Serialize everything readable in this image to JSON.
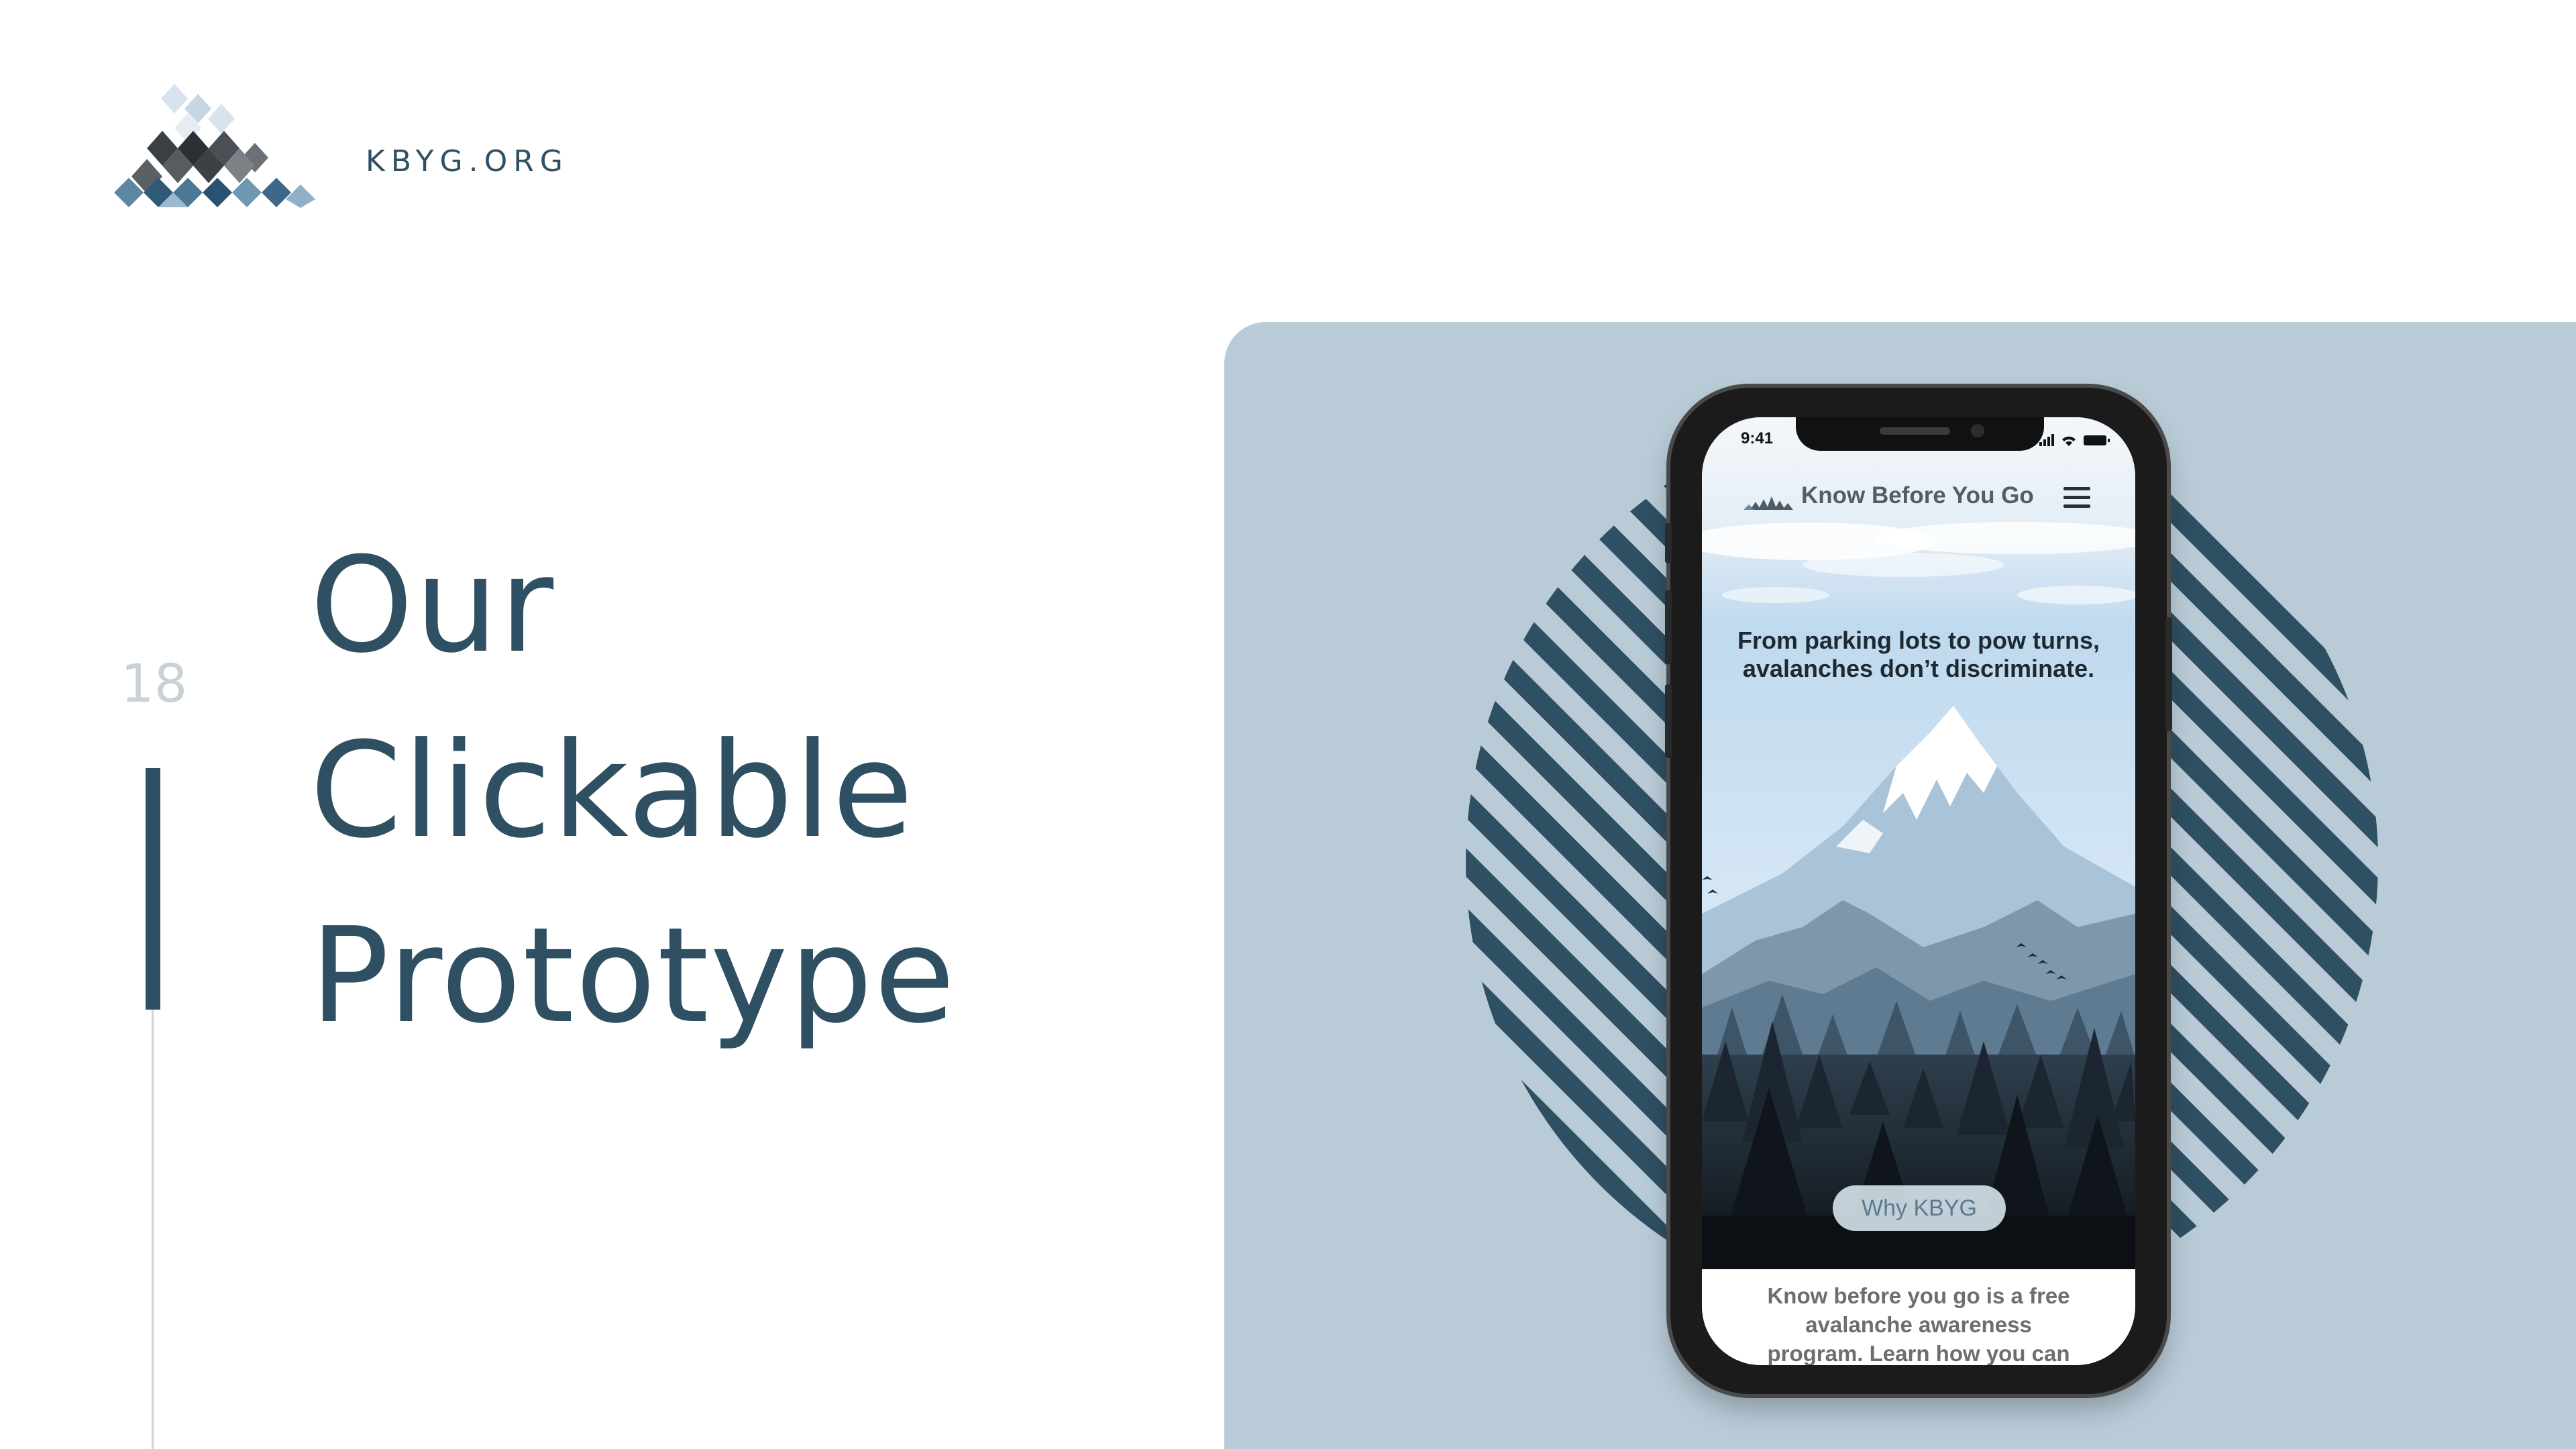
{
  "header": {
    "site_label": "KBYG.ORG"
  },
  "slide": {
    "number": "18",
    "title_lines": [
      "Our",
      "Clickable",
      "Prototype"
    ]
  },
  "phone": {
    "status_time": "9:41",
    "app_name": "Know Before You Go",
    "tagline_lines": [
      "From parking lots to pow turns,",
      "avalanches don’t discriminate."
    ],
    "cta_label": "Why KBYG",
    "intro_lines": [
      "Know before you go is a free",
      "avalanche awareness",
      "program. Learn how you can"
    ]
  },
  "colors": {
    "brand_navy": "#2f4f62",
    "panel_blue": "#b8cbd7",
    "slide_number_gray": "#c9d1d6"
  },
  "icons": {
    "logo": "kbyg-mountain-logo",
    "menu": "hamburger-menu-icon",
    "status": "signal-wifi-battery-icons"
  }
}
